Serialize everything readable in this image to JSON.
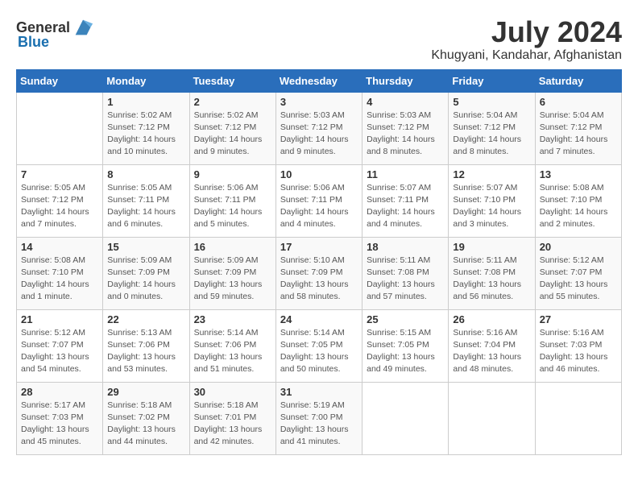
{
  "header": {
    "logo_general": "General",
    "logo_blue": "Blue",
    "month_year": "July 2024",
    "location": "Khugyani, Kandahar, Afghanistan"
  },
  "weekdays": [
    "Sunday",
    "Monday",
    "Tuesday",
    "Wednesday",
    "Thursday",
    "Friday",
    "Saturday"
  ],
  "weeks": [
    [
      {
        "day": "",
        "info": ""
      },
      {
        "day": "1",
        "info": "Sunrise: 5:02 AM\nSunset: 7:12 PM\nDaylight: 14 hours\nand 10 minutes."
      },
      {
        "day": "2",
        "info": "Sunrise: 5:02 AM\nSunset: 7:12 PM\nDaylight: 14 hours\nand 9 minutes."
      },
      {
        "day": "3",
        "info": "Sunrise: 5:03 AM\nSunset: 7:12 PM\nDaylight: 14 hours\nand 9 minutes."
      },
      {
        "day": "4",
        "info": "Sunrise: 5:03 AM\nSunset: 7:12 PM\nDaylight: 14 hours\nand 8 minutes."
      },
      {
        "day": "5",
        "info": "Sunrise: 5:04 AM\nSunset: 7:12 PM\nDaylight: 14 hours\nand 8 minutes."
      },
      {
        "day": "6",
        "info": "Sunrise: 5:04 AM\nSunset: 7:12 PM\nDaylight: 14 hours\nand 7 minutes."
      }
    ],
    [
      {
        "day": "7",
        "info": "Sunrise: 5:05 AM\nSunset: 7:12 PM\nDaylight: 14 hours\nand 7 minutes."
      },
      {
        "day": "8",
        "info": "Sunrise: 5:05 AM\nSunset: 7:11 PM\nDaylight: 14 hours\nand 6 minutes."
      },
      {
        "day": "9",
        "info": "Sunrise: 5:06 AM\nSunset: 7:11 PM\nDaylight: 14 hours\nand 5 minutes."
      },
      {
        "day": "10",
        "info": "Sunrise: 5:06 AM\nSunset: 7:11 PM\nDaylight: 14 hours\nand 4 minutes."
      },
      {
        "day": "11",
        "info": "Sunrise: 5:07 AM\nSunset: 7:11 PM\nDaylight: 14 hours\nand 4 minutes."
      },
      {
        "day": "12",
        "info": "Sunrise: 5:07 AM\nSunset: 7:10 PM\nDaylight: 14 hours\nand 3 minutes."
      },
      {
        "day": "13",
        "info": "Sunrise: 5:08 AM\nSunset: 7:10 PM\nDaylight: 14 hours\nand 2 minutes."
      }
    ],
    [
      {
        "day": "14",
        "info": "Sunrise: 5:08 AM\nSunset: 7:10 PM\nDaylight: 14 hours\nand 1 minute."
      },
      {
        "day": "15",
        "info": "Sunrise: 5:09 AM\nSunset: 7:09 PM\nDaylight: 14 hours\nand 0 minutes."
      },
      {
        "day": "16",
        "info": "Sunrise: 5:09 AM\nSunset: 7:09 PM\nDaylight: 13 hours\nand 59 minutes."
      },
      {
        "day": "17",
        "info": "Sunrise: 5:10 AM\nSunset: 7:09 PM\nDaylight: 13 hours\nand 58 minutes."
      },
      {
        "day": "18",
        "info": "Sunrise: 5:11 AM\nSunset: 7:08 PM\nDaylight: 13 hours\nand 57 minutes."
      },
      {
        "day": "19",
        "info": "Sunrise: 5:11 AM\nSunset: 7:08 PM\nDaylight: 13 hours\nand 56 minutes."
      },
      {
        "day": "20",
        "info": "Sunrise: 5:12 AM\nSunset: 7:07 PM\nDaylight: 13 hours\nand 55 minutes."
      }
    ],
    [
      {
        "day": "21",
        "info": "Sunrise: 5:12 AM\nSunset: 7:07 PM\nDaylight: 13 hours\nand 54 minutes."
      },
      {
        "day": "22",
        "info": "Sunrise: 5:13 AM\nSunset: 7:06 PM\nDaylight: 13 hours\nand 53 minutes."
      },
      {
        "day": "23",
        "info": "Sunrise: 5:14 AM\nSunset: 7:06 PM\nDaylight: 13 hours\nand 51 minutes."
      },
      {
        "day": "24",
        "info": "Sunrise: 5:14 AM\nSunset: 7:05 PM\nDaylight: 13 hours\nand 50 minutes."
      },
      {
        "day": "25",
        "info": "Sunrise: 5:15 AM\nSunset: 7:05 PM\nDaylight: 13 hours\nand 49 minutes."
      },
      {
        "day": "26",
        "info": "Sunrise: 5:16 AM\nSunset: 7:04 PM\nDaylight: 13 hours\nand 48 minutes."
      },
      {
        "day": "27",
        "info": "Sunrise: 5:16 AM\nSunset: 7:03 PM\nDaylight: 13 hours\nand 46 minutes."
      }
    ],
    [
      {
        "day": "28",
        "info": "Sunrise: 5:17 AM\nSunset: 7:03 PM\nDaylight: 13 hours\nand 45 minutes."
      },
      {
        "day": "29",
        "info": "Sunrise: 5:18 AM\nSunset: 7:02 PM\nDaylight: 13 hours\nand 44 minutes."
      },
      {
        "day": "30",
        "info": "Sunrise: 5:18 AM\nSunset: 7:01 PM\nDaylight: 13 hours\nand 42 minutes."
      },
      {
        "day": "31",
        "info": "Sunrise: 5:19 AM\nSunset: 7:00 PM\nDaylight: 13 hours\nand 41 minutes."
      },
      {
        "day": "",
        "info": ""
      },
      {
        "day": "",
        "info": ""
      },
      {
        "day": "",
        "info": ""
      }
    ]
  ]
}
